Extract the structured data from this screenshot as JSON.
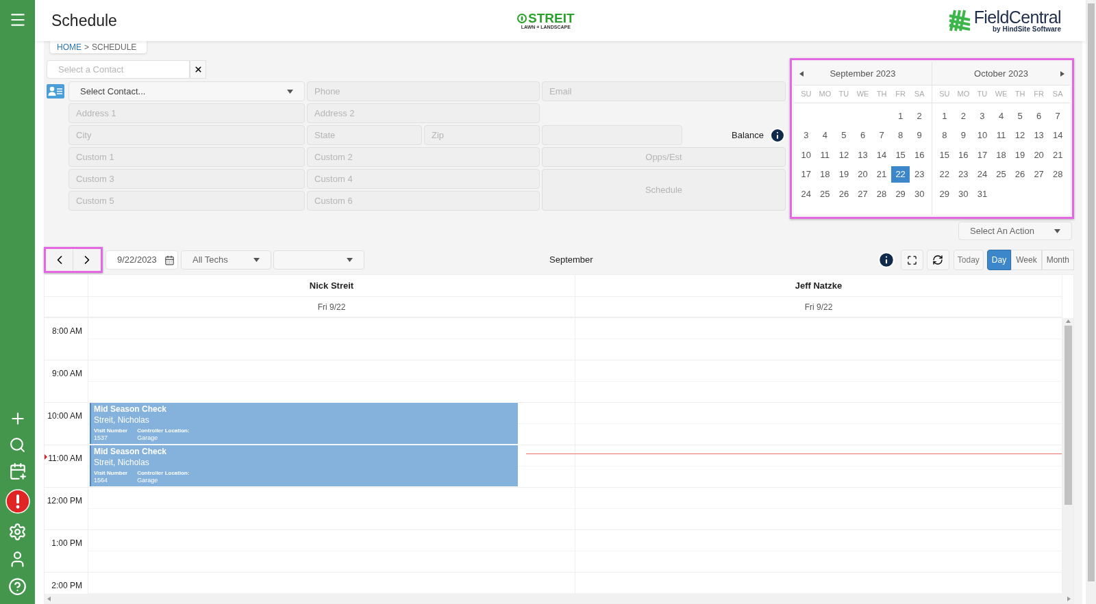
{
  "header": {
    "title": "Schedule",
    "company_logo": {
      "name": "STREIT",
      "tagline": "LAWN + LANDSCAPE"
    },
    "brand_logo": {
      "name": "FieldCentral",
      "tagline": "by HindSite Software"
    }
  },
  "breadcrumb": {
    "home": "HOME",
    "separator": ">",
    "current": "SCHEDULE"
  },
  "contact_search": {
    "placeholder": "Select a Contact"
  },
  "contact_form": {
    "select": "Select Contact...",
    "phone": "Phone",
    "email": "Email",
    "address_1": "Address 1",
    "address_2": "Address 2",
    "city": "City",
    "state": "State",
    "zip": "Zip",
    "balance": "Balance",
    "custom": [
      "Custom 1",
      "Custom 2",
      "Custom 3",
      "Custom 4",
      "Custom 5",
      "Custom 6"
    ],
    "opps_button": "Opps/Est",
    "schedule_button": "Schedule"
  },
  "mini_calendar": {
    "highlighted": true,
    "months": [
      {
        "title": "September 2023",
        "weekdays": [
          "SU",
          "MO",
          "TU",
          "WE",
          "TH",
          "FR",
          "SA"
        ],
        "weeks": [
          {
            "kind": "lead",
            "days": [
              {
                "day": "1",
                "selected": false
              },
              {
                "day": "2",
                "selected": false
              }
            ]
          },
          {
            "kind": "full",
            "days": [
              {
                "day": "3",
                "selected": false
              },
              {
                "day": "4",
                "selected": false
              },
              {
                "day": "5",
                "selected": false
              },
              {
                "day": "6",
                "selected": false
              },
              {
                "day": "7",
                "selected": false
              },
              {
                "day": "8",
                "selected": false
              },
              {
                "day": "9",
                "selected": false
              }
            ]
          },
          {
            "kind": "full",
            "days": [
              {
                "day": "10",
                "selected": false
              },
              {
                "day": "11",
                "selected": false
              },
              {
                "day": "12",
                "selected": false
              },
              {
                "day": "13",
                "selected": false
              },
              {
                "day": "14",
                "selected": false
              },
              {
                "day": "15",
                "selected": false
              },
              {
                "day": "16",
                "selected": false
              }
            ]
          },
          {
            "kind": "full",
            "days": [
              {
                "day": "17",
                "selected": false
              },
              {
                "day": "18",
                "selected": false
              },
              {
                "day": "19",
                "selected": false
              },
              {
                "day": "20",
                "selected": false
              },
              {
                "day": "21",
                "selected": false
              },
              {
                "day": "22",
                "selected": true
              },
              {
                "day": "23",
                "selected": false
              }
            ]
          },
          {
            "kind": "full",
            "days": [
              {
                "day": "24",
                "selected": false
              },
              {
                "day": "25",
                "selected": false
              },
              {
                "day": "26",
                "selected": false
              },
              {
                "day": "27",
                "selected": false
              },
              {
                "day": "28",
                "selected": false
              },
              {
                "day": "29",
                "selected": false
              },
              {
                "day": "30",
                "selected": false
              }
            ]
          }
        ]
      },
      {
        "title": "October 2023",
        "weekdays": [
          "SU",
          "MO",
          "TU",
          "WE",
          "TH",
          "FR",
          "SA"
        ],
        "weeks": [
          {
            "kind": "full",
            "days": [
              {
                "day": "1",
                "selected": false
              },
              {
                "day": "2",
                "selected": false
              },
              {
                "day": "3",
                "selected": false
              },
              {
                "day": "4",
                "selected": false
              },
              {
                "day": "5",
                "selected": false
              },
              {
                "day": "6",
                "selected": false
              },
              {
                "day": "7",
                "selected": false
              }
            ]
          },
          {
            "kind": "full",
            "days": [
              {
                "day": "8",
                "selected": false
              },
              {
                "day": "9",
                "selected": false
              },
              {
                "day": "10",
                "selected": false
              },
              {
                "day": "11",
                "selected": false
              },
              {
                "day": "12",
                "selected": false
              },
              {
                "day": "13",
                "selected": false
              },
              {
                "day": "14",
                "selected": false
              }
            ]
          },
          {
            "kind": "full",
            "days": [
              {
                "day": "15",
                "selected": false
              },
              {
                "day": "16",
                "selected": false
              },
              {
                "day": "17",
                "selected": false
              },
              {
                "day": "18",
                "selected": false
              },
              {
                "day": "19",
                "selected": false
              },
              {
                "day": "20",
                "selected": false
              },
              {
                "day": "21",
                "selected": false
              }
            ]
          },
          {
            "kind": "full",
            "days": [
              {
                "day": "22",
                "selected": false
              },
              {
                "day": "23",
                "selected": false
              },
              {
                "day": "24",
                "selected": false
              },
              {
                "day": "25",
                "selected": false
              },
              {
                "day": "26",
                "selected": false
              },
              {
                "day": "27",
                "selected": false
              },
              {
                "day": "28",
                "selected": false
              }
            ]
          },
          {
            "kind": "trail",
            "days": [
              {
                "day": "29",
                "selected": false
              },
              {
                "day": "30",
                "selected": false
              },
              {
                "day": "31",
                "selected": false
              }
            ]
          }
        ]
      }
    ]
  },
  "action_select": {
    "value": "Select An Action"
  },
  "toolbar": {
    "nav_highlighted": true,
    "date": "9/22/2023",
    "tech_filter": "All Techs",
    "period_title": "September",
    "today": "Today",
    "views": [
      {
        "label": "Day",
        "selected": true
      },
      {
        "label": "Week",
        "selected": false
      },
      {
        "label": "Month",
        "selected": false
      }
    ]
  },
  "scheduler": {
    "resources": [
      {
        "name": "Nick Streit",
        "date": "Fri 9/22"
      },
      {
        "name": "Jeff Natzke",
        "date": "Fri 9/22"
      }
    ],
    "times": [
      "8:00 AM",
      "9:00 AM",
      "10:00 AM",
      "11:00 AM",
      "12:00 PM",
      "1:00 PM",
      "2:00 PM"
    ],
    "events": [
      {
        "title": "Mid Season Check",
        "customer": "Streit, Nicholas",
        "fields": [
          {
            "label": "Visit Number",
            "value": "1537"
          },
          {
            "label": "Controller Location:",
            "value": "Garage"
          }
        ]
      },
      {
        "title": "Mid Season Check",
        "customer": "Streit, Nicholas",
        "fields": [
          {
            "label": "Visit Number",
            "value": "1564"
          },
          {
            "label": "Controller Location:",
            "value": "Garage"
          }
        ]
      }
    ]
  }
}
